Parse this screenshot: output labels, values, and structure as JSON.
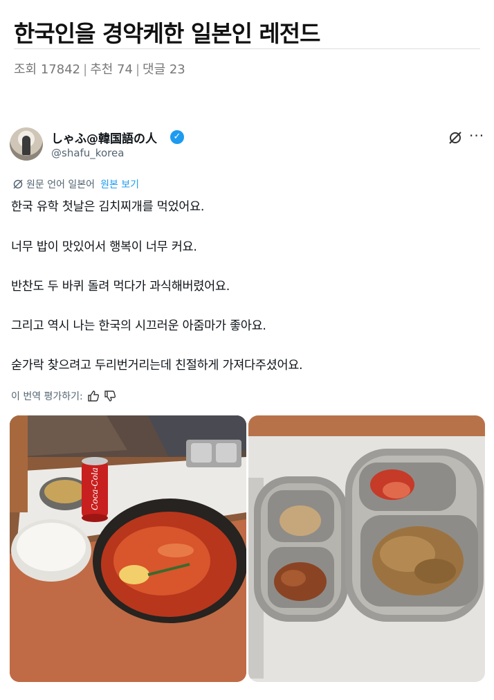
{
  "post": {
    "title": "한국인을 경악케한 일본인 레전드",
    "views_label": "조회 17842",
    "likes_label": "추천 74",
    "comments_label": "댓글 23",
    "separator": "|"
  },
  "tweet": {
    "display_name": "しゃふ@韓国語の人",
    "handle": "@shafu_korea",
    "verified_glyph": "✓",
    "more_glyph": "···",
    "translation_note": "원문 언어 일본어",
    "show_original": "원본 보기",
    "lines": [
      "한국 유학 첫날은 김치찌개를 먹었어요.",
      "너무 밥이 맛있어서 행복이 너무 커요.",
      "반찬도 두 바퀴 돌려 먹다가 과식해버렸어요.",
      "그리고 역시 나는 한국의 시끄러운 아줌마가 좋아요.",
      "숟가락 찾으려고 두리번거리는데 친절하게 가져다주셨어요."
    ],
    "rate_translation": "이 번역 평가하기:",
    "icons": [
      "globe-icon",
      "grok-icon",
      "more-icon",
      "verified-icon",
      "thumbs-up-icon",
      "thumbs-down-icon"
    ],
    "photos": {
      "left": {
        "subject": "kimchi stew, rice, soup and cola can"
      },
      "right": {
        "subject": "steel side-dish tray with kimchi and banchan"
      },
      "can_text": "Coca-Cola"
    }
  },
  "colors": {
    "link_blue": "#1d9bf0",
    "secondary_text": "#536471",
    "primary_text": "#0f1419"
  }
}
